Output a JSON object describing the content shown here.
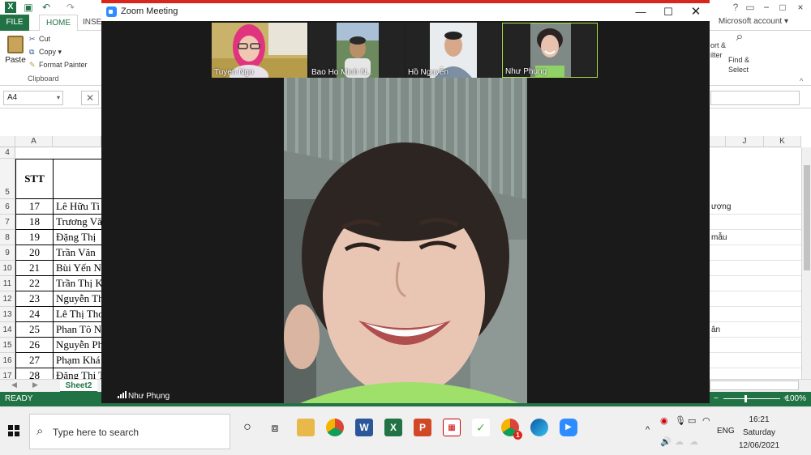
{
  "excel": {
    "tabs": {
      "file": "FILE",
      "home": "HOME",
      "insert": "INSER"
    },
    "account": "Microsoft account",
    "ribbon": {
      "paste": "Paste",
      "cut": "Cut",
      "copy": "Copy",
      "format_painter": "Format Painter",
      "clipboard_group": "Clipboard",
      "sort_filter": "ort &\nilter",
      "find_select": "Find &\nSelect"
    },
    "name_box": "A4",
    "columns": [
      "A",
      "J",
      "K"
    ],
    "table_header": "STT",
    "rows": [
      {
        "row": "4",
        "stt": "",
        "name": "",
        "right": ""
      },
      {
        "row": "5",
        "stt": "",
        "name": "",
        "right": ""
      },
      {
        "row": "6",
        "stt": "17",
        "name": "Lê Hữu Ti",
        "right": "ượng"
      },
      {
        "row": "7",
        "stt": "18",
        "name": "Trương Vă",
        "right": ""
      },
      {
        "row": "8",
        "stt": "19",
        "name": "Đặng Thị",
        "right": "mẫu"
      },
      {
        "row": "9",
        "stt": "20",
        "name": "Trần Văn",
        "right": ""
      },
      {
        "row": "10",
        "stt": "21",
        "name": "Bùi Yến N",
        "right": ""
      },
      {
        "row": "11",
        "stt": "22",
        "name": "Trần Thị K",
        "right": ""
      },
      {
        "row": "12",
        "stt": "23",
        "name": "Nguyễn Th",
        "right": ""
      },
      {
        "row": "13",
        "stt": "24",
        "name": "Lê Thị Tho",
        "right": ""
      },
      {
        "row": "14",
        "stt": "25",
        "name": "Phan Tô N",
        "right": "ân"
      },
      {
        "row": "15",
        "stt": "26",
        "name": "Nguyễn Ph",
        "right": ""
      },
      {
        "row": "16",
        "stt": "27",
        "name": "Phạm Khá",
        "right": ""
      },
      {
        "row": "17",
        "stt": "28",
        "name": "Đặng Thị T",
        "right": ""
      }
    ],
    "sheet_tab": "Sheet2",
    "status": "READY",
    "zoom": "100%"
  },
  "zoom": {
    "title": "Zoom Meeting",
    "participants": [
      {
        "name": "Tuyen Ngo"
      },
      {
        "name": "Bao Ho Minh N..."
      },
      {
        "name": "Hồ Nguyễn"
      },
      {
        "name": "Như Phụng"
      }
    ],
    "active_speaker": "Như Phụng"
  },
  "taskbar": {
    "search_placeholder": "Type here to search",
    "language": "ENG",
    "time": "16:21",
    "day": "Saturday",
    "date": "12/06/2021",
    "chrome_badge": "1"
  }
}
